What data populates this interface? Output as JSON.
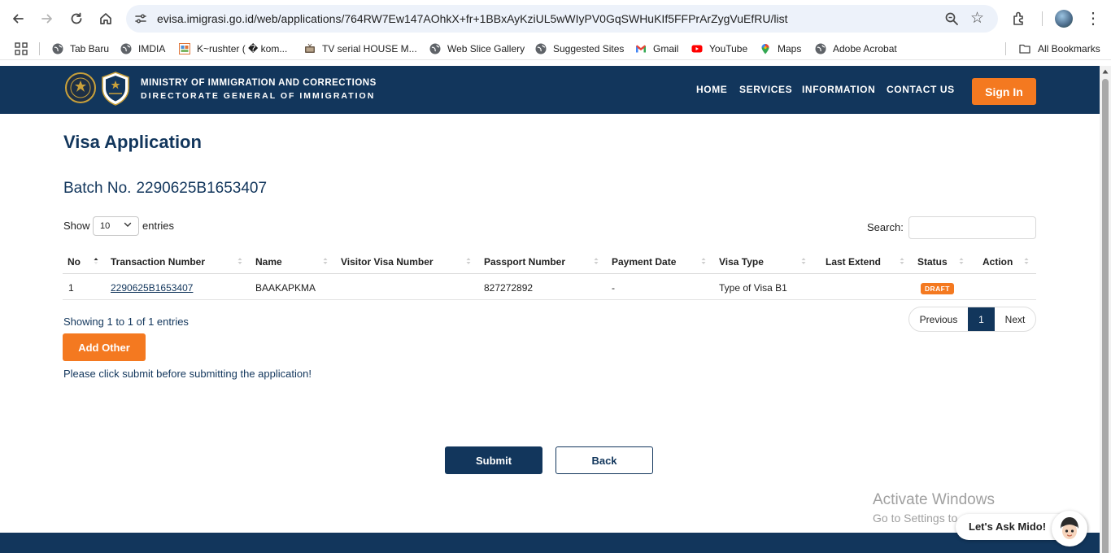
{
  "browser": {
    "url": "evisa.imigrasi.go.id/web/applications/764RW7Ew147AOhkX+fr+1BBxAyKziUL5wWIyPV0GqSWHuKIf5FFPrArZygVuEfRU/list",
    "bookmarks": [
      {
        "label": "Tab Baru",
        "icon": "globe-icon"
      },
      {
        "label": "IMDIA",
        "icon": "globe-icon"
      },
      {
        "label": "K~rushter ( � kom...",
        "icon": "grid-image-icon"
      },
      {
        "label": "TV serial HOUSE M...",
        "icon": "tv-icon"
      },
      {
        "label": "Web Slice Gallery",
        "icon": "globe-icon"
      },
      {
        "label": "Suggested Sites",
        "icon": "globe-icon"
      },
      {
        "label": "Gmail",
        "icon": "gmail-icon"
      },
      {
        "label": "YouTube",
        "icon": "youtube-icon"
      },
      {
        "label": "Maps",
        "icon": "maps-pin-icon"
      },
      {
        "label": "Adobe Acrobat",
        "icon": "globe-icon"
      }
    ],
    "all_bookmarks": "All Bookmarks"
  },
  "header": {
    "org_line1": "MINISTRY OF IMMIGRATION AND CORRECTIONS",
    "org_line2": "DIRECTORATE GENERAL OF IMMIGRATION",
    "menu": [
      "HOME",
      "SERVICES",
      "INFORMATION",
      "CONTACT US"
    ],
    "sign_in": "Sign In",
    "colors": {
      "navy": "#12365c",
      "orange": "#f47920"
    }
  },
  "main": {
    "title": "Visa Application",
    "batch_label": "Batch No.",
    "batch_number": "2290625B1653407",
    "show_label": "Show",
    "page_length": "10",
    "entries_label": "entries",
    "search_label": "Search:",
    "search_value": "",
    "columns": [
      "No",
      "Transaction Number",
      "Name",
      "Visitor Visa Number",
      "Passport Number",
      "Payment Date",
      "Visa Type",
      "Last Extend",
      "Status",
      "Action"
    ],
    "rows": [
      {
        "no": "1",
        "transaction_number": "2290625B1653407",
        "name": "BAAKAPKMA",
        "visitor_visa_number": "",
        "passport_number": "827272892",
        "payment_date": "-",
        "visa_type": "Type of Visa B1",
        "last_extend": "",
        "status": "DRAFT",
        "action": ""
      }
    ],
    "info_text": "Showing 1 to 1 of 1 entries",
    "pager": {
      "previous": "Previous",
      "current": "1",
      "next": "Next"
    },
    "add_other": "Add Other",
    "note": "Please click submit before submitting the application!",
    "submit": "Submit",
    "back": "Back"
  },
  "overlay": {
    "activate_title": "Activate Windows",
    "activate_sub": "Go to Settings to activate Windows.",
    "chat_label": "Let's Ask Mido!"
  }
}
